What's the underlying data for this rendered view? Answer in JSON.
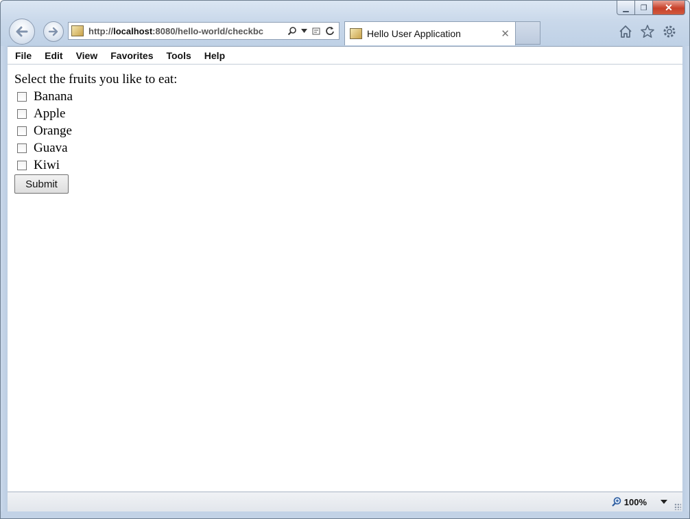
{
  "window": {
    "caption": {
      "minimize": "▁",
      "maximize": "❐",
      "close": "✕"
    }
  },
  "nav": {
    "back_icon": "back-arrow-icon",
    "forward_icon": "forward-arrow-icon"
  },
  "address": {
    "url_prefix": "http://",
    "url_host": "localhost",
    "url_rest": ":8080/hello-world/checkbc",
    "icons": [
      "search-icon",
      "dropdown-icon",
      "compatibility-icon",
      "refresh-icon"
    ]
  },
  "tab": {
    "title": "Hello User Application",
    "close": "✕"
  },
  "toolbar_icons": [
    "home-icon",
    "favorites-star-icon",
    "gear-icon"
  ],
  "menu": {
    "items": [
      "File",
      "Edit",
      "View",
      "Favorites",
      "Tools",
      "Help"
    ]
  },
  "form": {
    "prompt": "Select the fruits you like to eat:",
    "options": [
      {
        "label": "Banana",
        "checked": false
      },
      {
        "label": "Apple",
        "checked": false
      },
      {
        "label": "Orange",
        "checked": false
      },
      {
        "label": "Guava",
        "checked": false
      },
      {
        "label": "Kiwi",
        "checked": false
      }
    ],
    "submit_label": "Submit"
  },
  "status": {
    "zoom": "100%"
  }
}
